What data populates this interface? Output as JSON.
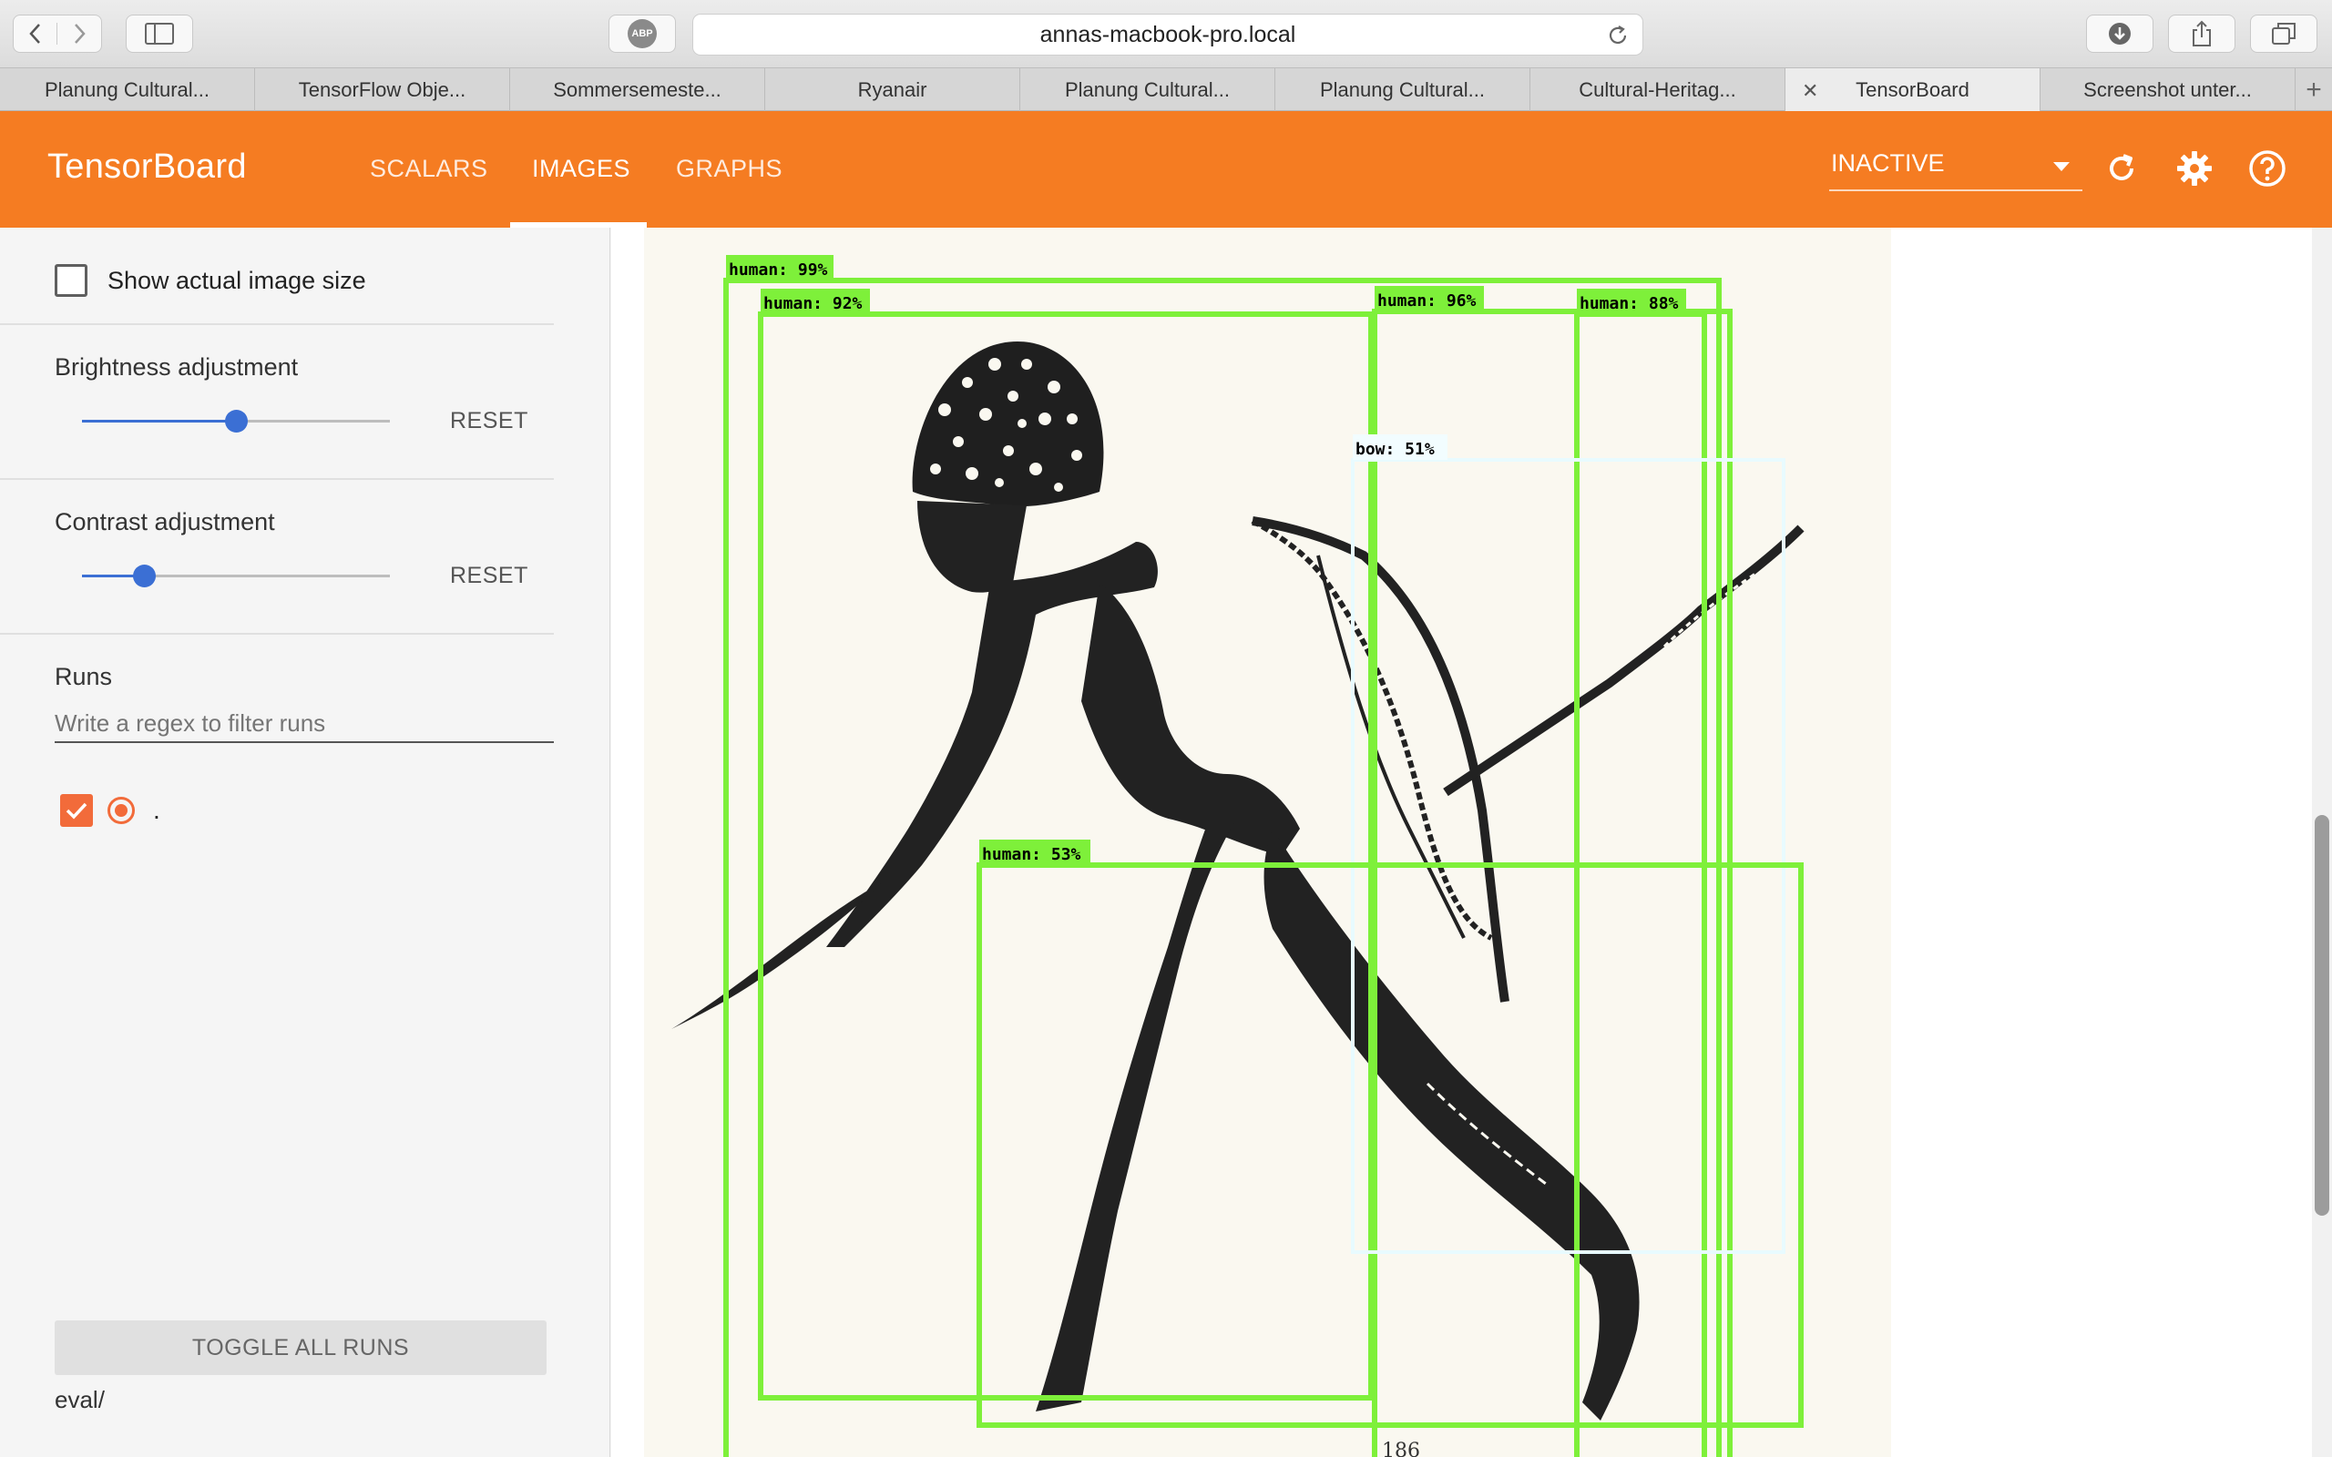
{
  "browser": {
    "url": "annas-macbook-pro.local",
    "adblock_label": "ABP",
    "tabs": [
      {
        "label": "Planung Cultural..."
      },
      {
        "label": "TensorFlow Obje..."
      },
      {
        "label": "Sommersemeste..."
      },
      {
        "label": "Ryanair"
      },
      {
        "label": "Planung Cultural..."
      },
      {
        "label": "Planung Cultural..."
      },
      {
        "label": "Cultural-Heritag..."
      },
      {
        "label": "TensorBoard",
        "active": true
      },
      {
        "label": "Screenshot unter..."
      }
    ]
  },
  "header": {
    "logo": "TensorBoard",
    "nav": [
      "SCALARS",
      "IMAGES",
      "GRAPHS"
    ],
    "active_nav": "IMAGES",
    "run_select": "INACTIVE",
    "accent_color": "#f57c22"
  },
  "sidebar": {
    "actual_size_label": "Show actual image size",
    "brightness_title": "Brightness adjustment",
    "brightness_value": 0.5,
    "contrast_title": "Contrast adjustment",
    "contrast_value": 0.2,
    "reset_label": "RESET",
    "runs_title": "Runs",
    "filter_placeholder": "Write a regex to filter runs",
    "run_name": ".",
    "toggle_all_label": "TOGGLE ALL RUNS",
    "eval_label": "eval/"
  },
  "detections": [
    {
      "label": "human: 99%",
      "color": "#7ef03a"
    },
    {
      "label": "human: 92%",
      "color": "#7ef03a"
    },
    {
      "label": "human: 96%",
      "color": "#7ef03a"
    },
    {
      "label": "human: 88%",
      "color": "#7ef03a"
    },
    {
      "label": "bow: 51%",
      "color": "#e8fbff"
    },
    {
      "label": "human: 53%",
      "color": "#7ef03a"
    }
  ],
  "image_footer_text": "186"
}
